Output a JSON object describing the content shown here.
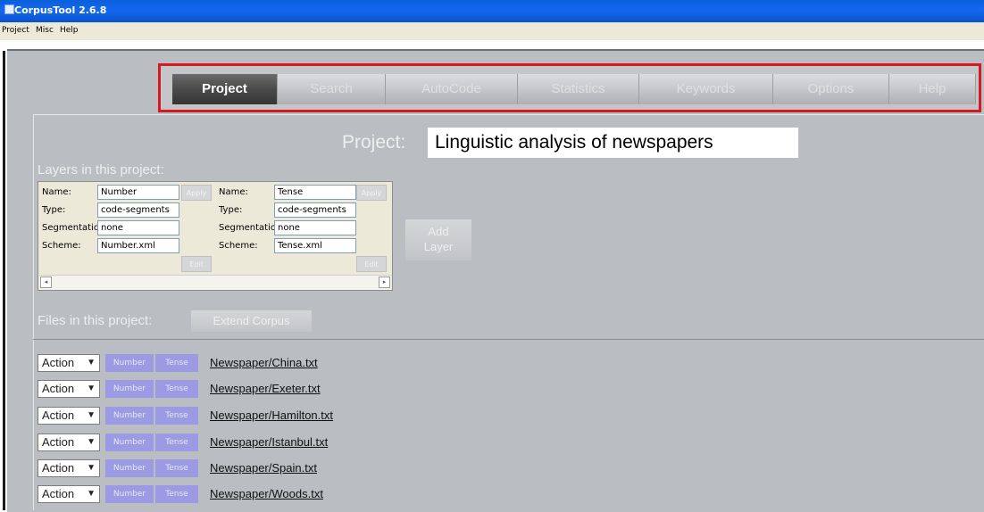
{
  "window": {
    "title": "CorpusTool 2.6.8"
  },
  "menu": [
    "Project",
    "Misc",
    "Help"
  ],
  "tabs": [
    {
      "label": "Project",
      "active": true
    },
    {
      "label": "Search",
      "active": false
    },
    {
      "label": "AutoCode",
      "active": false
    },
    {
      "label": "Statistics",
      "active": false
    },
    {
      "label": "Keywords",
      "active": false
    },
    {
      "label": "Options",
      "active": false
    },
    {
      "label": "Help",
      "active": false
    }
  ],
  "project": {
    "label": "Project:",
    "name": "Linguistic analysis of newspapers"
  },
  "layers_section": {
    "label": "Layers in this project:",
    "layers": [
      {
        "name_label": "Name:",
        "name": "Number",
        "type_label": "Type:",
        "type": "code-segments",
        "segmentation_label": "Segmentation:",
        "segmentation": "none",
        "scheme_label": "Scheme:",
        "scheme": "Number.xml",
        "apply_button": "Apply",
        "edit_button": "Edit"
      },
      {
        "name_label": "Name:",
        "name": "Tense",
        "type_label": "Type:",
        "type": "code-segments",
        "segmentation_label": "Segmentation:",
        "segmentation": "none",
        "scheme_label": "Scheme:",
        "scheme": "Tense.xml",
        "apply_button": "Apply",
        "edit_button": "Edit"
      }
    ],
    "add_layer_button": "Add\nLayer"
  },
  "files_section": {
    "label": "Files in this project:",
    "extend_button": "Extend Corpus",
    "action_label": "Action",
    "layer_tags": [
      "Number",
      "Tense"
    ],
    "files": [
      "Newspaper/China.txt",
      "Newspaper/Exeter.txt",
      "Newspaper/Hamilton.txt",
      "Newspaper/Istanbul.txt",
      "Newspaper/Spain.txt",
      "Newspaper/Woods.txt"
    ]
  },
  "colors": {
    "titlebar": "#0a5fdc",
    "panel": "#babdc2",
    "highlight": "#d61821",
    "active_tab": "#4a4a4a",
    "layer_tag": "#9b9ae2"
  },
  "icons": {
    "app": "corpustool-icon",
    "dropdown": "caret-down-icon"
  }
}
